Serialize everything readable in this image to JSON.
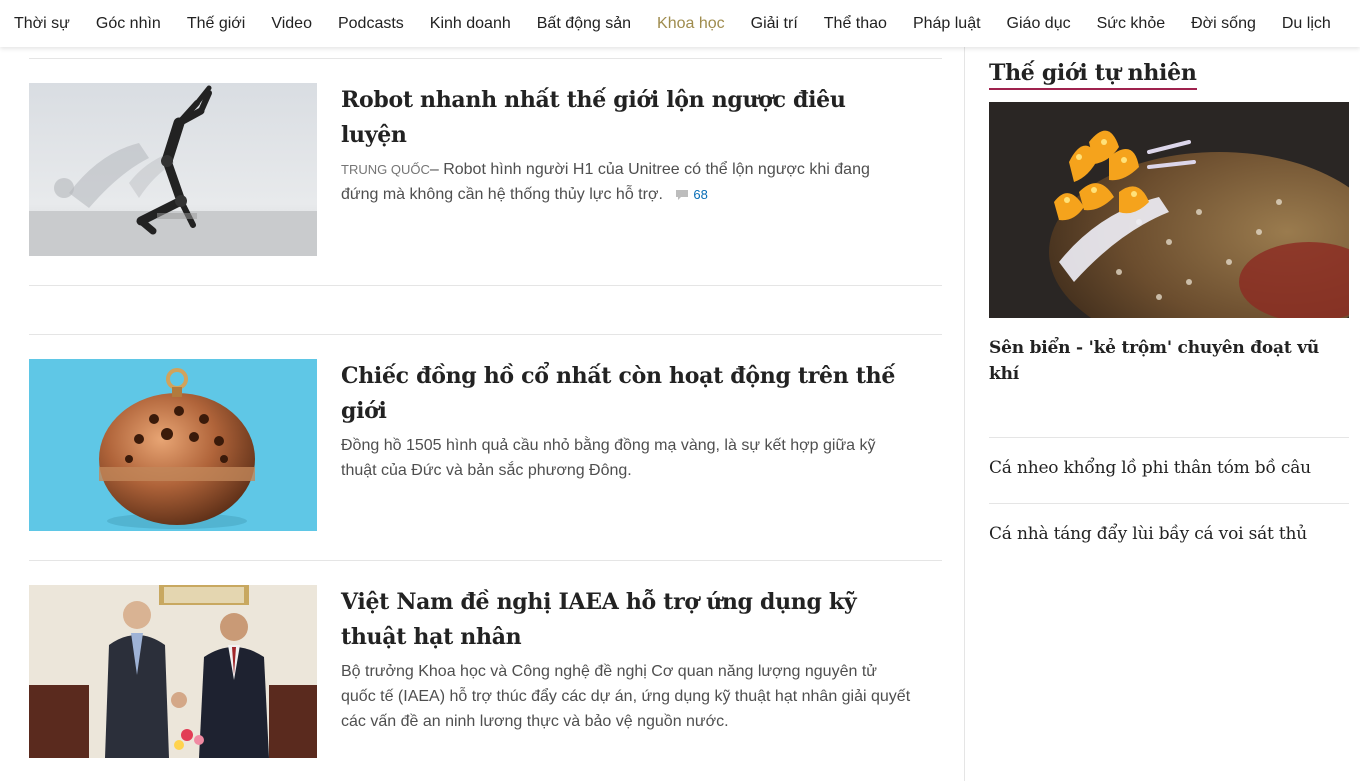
{
  "nav": {
    "items": [
      "Thời sự",
      "Góc nhìn",
      "Thế giới",
      "Video",
      "Podcasts",
      "Kinh doanh",
      "Bất động sản",
      "Khoa học",
      "Giải trí",
      "Thể thao",
      "Pháp luật",
      "Giáo dục",
      "Sức khỏe",
      "Đời sống",
      "Du lịch"
    ],
    "active": "Khoa học"
  },
  "articles": [
    {
      "title": "Robot nhanh nhất thế giới lộn ngược điêu luyện",
      "location": "TRUNG QUỐC",
      "separator": "–",
      "description": "Robot hình người H1 của Unitree có thể lộn ngược khi đang đứng mà không cần hệ thống thủy lực hỗ trợ.",
      "comment_count": "68"
    },
    {
      "title": "Chiếc đồng hồ cổ nhất còn hoạt động trên thế giới",
      "description": "Đồng hồ 1505 hình quả cầu nhỏ bằng đồng mạ vàng, là sự kết hợp giữa kỹ thuật của Đức và bản sắc phương Đông."
    },
    {
      "title": "Việt Nam đề nghị IAEA hỗ trợ ứng dụng kỹ thuật hạt nhân",
      "description": "Bộ trưởng Khoa học và Công nghệ đề nghị Cơ quan năng lượng nguyên tử quốc tế (IAEA) hỗ trợ thúc đẩy các dự án, ứng dụng kỹ thuật hạt nhân giải quyết các vấn đề an ninh lương thực và bảo vệ nguồn nước."
    }
  ],
  "sidebar": {
    "heading": "Thế giới tự nhiên",
    "featured_title": "Sên biển - 'kẻ trộm' chuyên đoạt vũ khí",
    "items": [
      "Cá nheo khổng lồ phi thân tóm bồ câu",
      "Cá nhà táng đẩy lùi bầy cá voi sát thủ"
    ]
  },
  "colors": {
    "active_nav": "#9f8c4e",
    "heading_underline": "#9f224e",
    "comment_link": "#076db6"
  },
  "icons": [
    "comment-icon"
  ]
}
